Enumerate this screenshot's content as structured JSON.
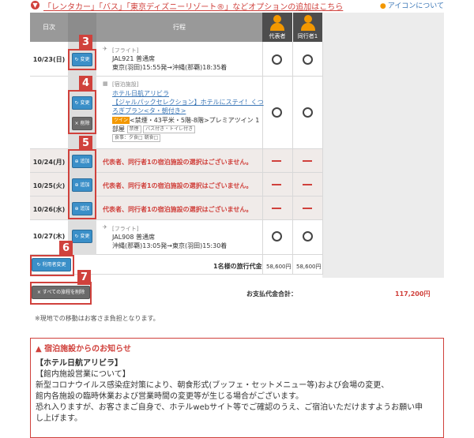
{
  "header": {
    "options_text": "「レンタカー」「バス」「東京ディズニーリゾート®」などオプションの追加はこちら",
    "icon_help": "アイコンについて"
  },
  "columns": {
    "date": "日次",
    "itinerary": "行程",
    "rep": "代表者",
    "companion": "同行者1"
  },
  "rows": {
    "r1": {
      "date": "10/23(日)",
      "button": "変更",
      "type": "[フライト]",
      "line1": "JAL921 普通席",
      "line2": "東京(羽田)15:55発→沖縄(那覇)18:35着"
    },
    "r2": {
      "button_change": "変更",
      "button_delete": "削除",
      "type": "[宿泊施設]",
      "hotel": "ホテル日航アリビラ",
      "plan1": "【ジャルパックセレクション】ホテルにステイ！くつ",
      "plan2": "ろぎプラン<タ・朝付き>",
      "badge": "ツイン",
      "room": "<禁煙・43平米・5階-8階>プレミアツイン 1",
      "room2": "部屋",
      "tag1": "禁煙",
      "tag2": "バス付き・トイレ付き",
      "tag3": "食事：夕食□ 朝食□"
    },
    "r3": {
      "date": "10/24(月)",
      "button": "追加",
      "message": "代表者、同行者1の宿泊施設の選択はございません。"
    },
    "r4": {
      "date": "10/25(火)",
      "button": "追加",
      "message": "代表者、同行者1の宿泊施設の選択はございません。"
    },
    "r5": {
      "date": "10/26(水)",
      "button": "追加",
      "message": "代表者、同行者1の宿泊施設の選択はございません。"
    },
    "r6": {
      "date": "10/27(木)",
      "button": "変更",
      "type": "[フライト]",
      "line1": "JAL908 普通席",
      "line2": "沖縄(那覇)13:05発→東京(羽田)15:30着"
    }
  },
  "badges": {
    "b3": "3",
    "b4": "4",
    "b5": "5",
    "b6": "6",
    "b7": "7"
  },
  "footer_rows": {
    "change_user_button": "利用者変更",
    "per_person_label": "1名様の旅行代金",
    "price_rep": "58,600円",
    "price_comp": "58,600円",
    "delete_all_button": "すべての旅程を削除",
    "total_label": "お支払代金合計：",
    "total_value": "117,200円"
  },
  "note": "※現地での移動はお客さま負担となります。",
  "notice": {
    "title": "宿泊施設からのお知らせ",
    "hotel": "【ホテル日航アリビラ】",
    "l1": "【館内施設営業について】",
    "l2": "新型コロナウイルス感染症対策により、朝食形式(ブッフェ・セットメニュー等)および会場の変更、",
    "l3": "館内各施設の臨時休業および営業時間の変更等が生じる場合がございます。",
    "l4": "恐れ入りますが、お客さまご自身で、ホテルwebサイト等でご確認のうえ、ご宿泊いただけますようお願い申",
    "l5": "し上げます。"
  },
  "colors": {
    "accent_red": "#d0413c",
    "blue_button": "#3a8fc8",
    "orange": "#f39800"
  }
}
